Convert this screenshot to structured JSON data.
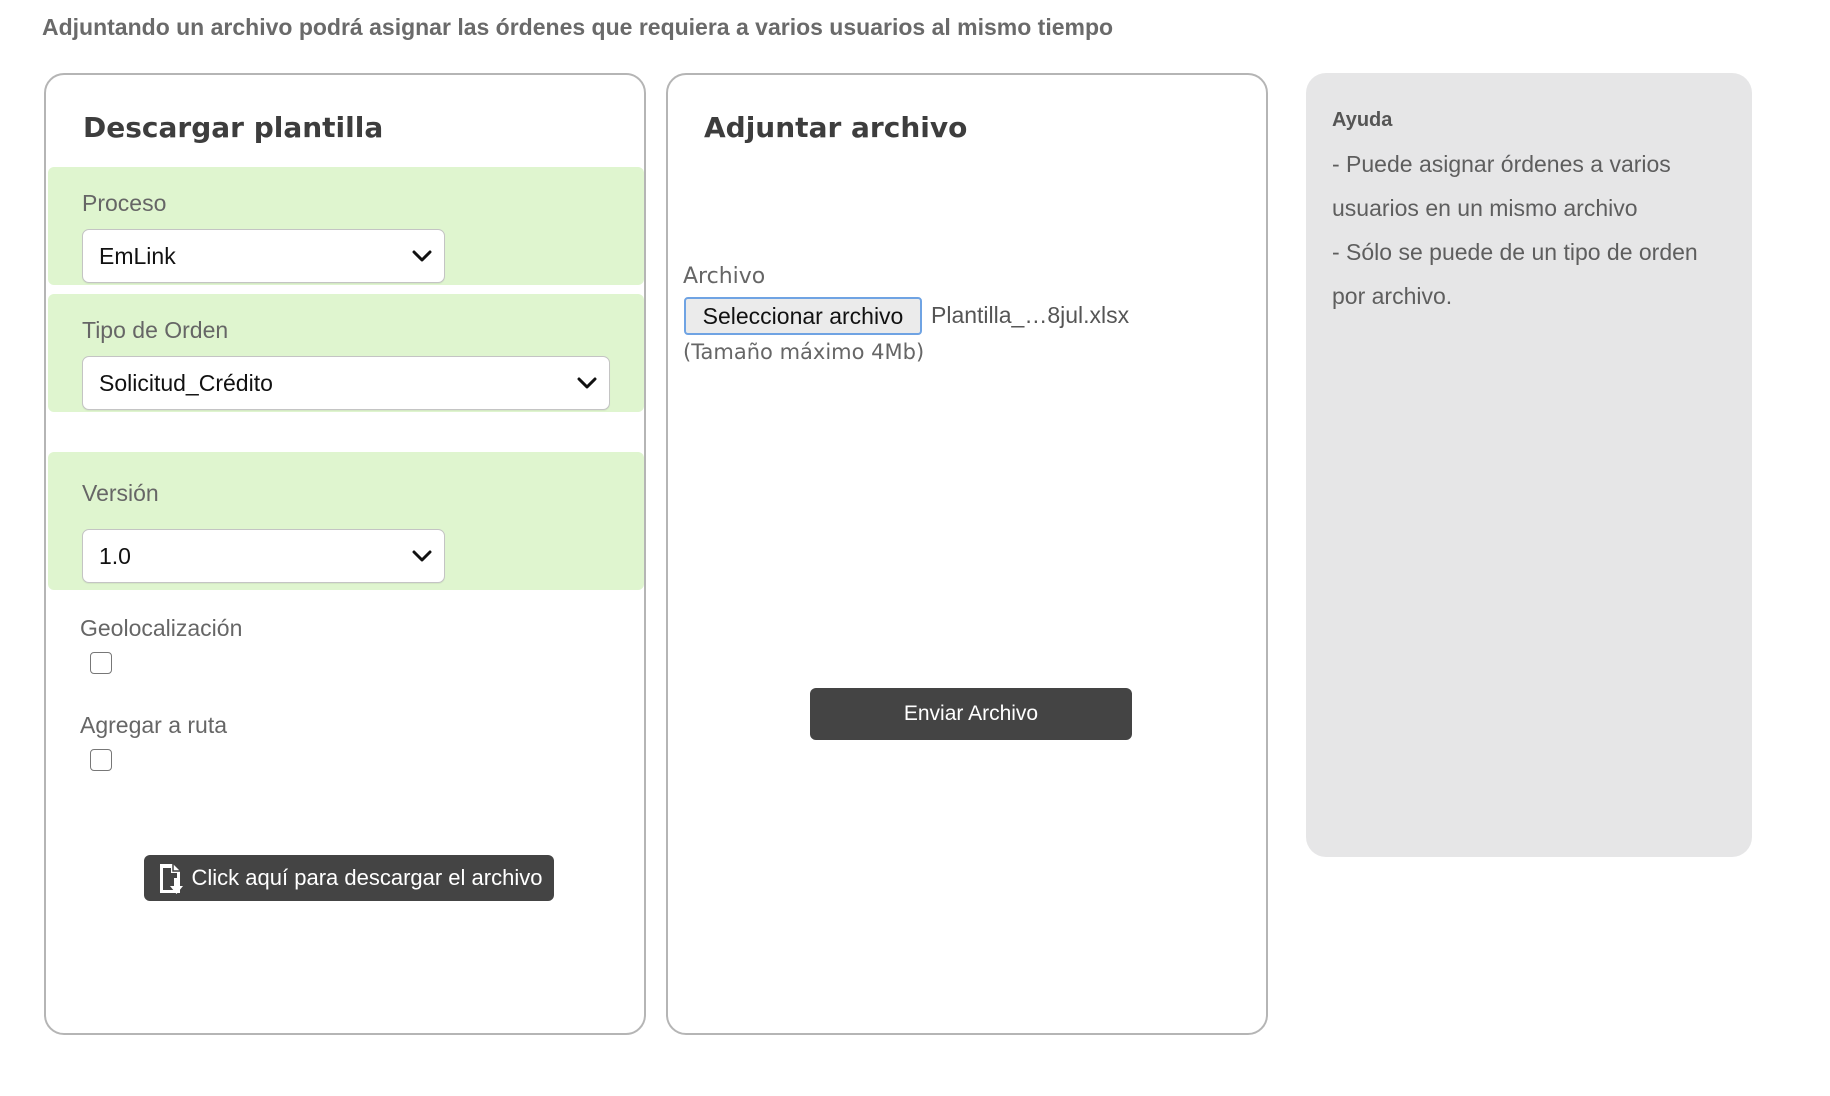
{
  "intro": "Adjuntando un archivo podrá asignar las órdenes que requiera a varios usuarios al mismo tiempo",
  "template_panel": {
    "title": "Descargar plantilla",
    "proceso": {
      "label": "Proceso",
      "value": "EmLink"
    },
    "tipo_orden": {
      "label": "Tipo de Orden",
      "value": "Solicitud_Crédito"
    },
    "version": {
      "label": "Versión",
      "value": "1.0"
    },
    "geolocalizacion": {
      "label": "Geolocalización",
      "checked": false
    },
    "agregar_ruta": {
      "label": "Agregar a ruta",
      "checked": false
    },
    "download_button": "Click aquí para descargar el archivo",
    "colors": {
      "highlight": "#dff5cf",
      "button": "#444444"
    }
  },
  "attach_panel": {
    "title": "Adjuntar archivo",
    "file_label": "Archivo",
    "select_button": "Seleccionar archivo",
    "file_name": "Plantilla_…8jul.xlsx",
    "hint": "(Tamaño máximo 4Mb)",
    "send_button": "Enviar Archivo"
  },
  "help": {
    "title": "Ayuda",
    "lines": [
      "- Puede asignar órdenes a varios",
      "usuarios en un mismo archivo",
      "- Sólo se puede de un tipo de orden",
      "por archivo."
    ]
  }
}
